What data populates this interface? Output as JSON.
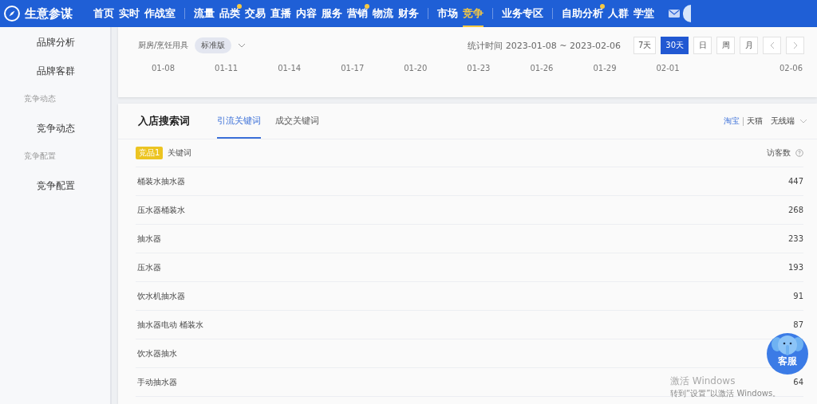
{
  "app": {
    "name": "生意参谋"
  },
  "nav": [
    [
      {
        "label": "首页",
        "selected": false,
        "dot": false
      },
      {
        "label": "实时",
        "selected": false,
        "dot": false
      },
      {
        "label": "作战室",
        "selected": false,
        "dot": false
      }
    ],
    [
      {
        "label": "流量",
        "selected": false,
        "dot": false
      },
      {
        "label": "品类",
        "selected": false,
        "dot": true
      },
      {
        "label": "交易",
        "selected": false,
        "dot": false
      },
      {
        "label": "直播",
        "selected": false,
        "dot": false
      },
      {
        "label": "内容",
        "selected": false,
        "dot": false
      },
      {
        "label": "服务",
        "selected": false,
        "dot": false
      },
      {
        "label": "营销",
        "selected": false,
        "dot": true
      },
      {
        "label": "物流",
        "selected": false,
        "dot": false
      },
      {
        "label": "财务",
        "selected": false,
        "dot": false
      }
    ],
    [
      {
        "label": "市场",
        "selected": false,
        "dot": false
      },
      {
        "label": "竞争",
        "selected": true,
        "dot": false
      }
    ],
    [
      {
        "label": "业务专区",
        "selected": false,
        "dot": false
      }
    ],
    [
      {
        "label": "自助分析",
        "selected": false,
        "dot": true
      },
      {
        "label": "人群",
        "selected": false,
        "dot": false
      },
      {
        "label": "学堂",
        "selected": false,
        "dot": false
      }
    ]
  ],
  "sidebar": [
    {
      "kind": "item",
      "label": "品牌分析"
    },
    {
      "kind": "item",
      "label": "品牌客群"
    },
    {
      "kind": "section",
      "label": "竞争动态"
    },
    {
      "kind": "item",
      "label": "竞争动态"
    },
    {
      "kind": "section",
      "label": "竞争配置"
    },
    {
      "kind": "item",
      "label": "竞争配置"
    }
  ],
  "filter": {
    "category": "厨房/烹饪用具",
    "edition": "标准版",
    "period_label": "统计时间 2023-01-08 ~ 2023-02-06",
    "ranges": [
      {
        "label": "7天",
        "selected": false
      },
      {
        "label": "30天",
        "selected": true
      },
      {
        "label": "日",
        "selected": false
      },
      {
        "label": "周",
        "selected": false
      },
      {
        "label": "月",
        "selected": false
      }
    ]
  },
  "axis_labels": [
    "01-08",
    "01-11",
    "01-14",
    "01-17",
    "01-20",
    "01-23",
    "01-26",
    "01-29",
    "02-01",
    "02-06"
  ],
  "keywords": {
    "title": "入店搜索词",
    "tabs": [
      {
        "label": "引流关键词",
        "selected": true
      },
      {
        "label": "成交关键词",
        "selected": false
      }
    ],
    "platforms": [
      {
        "label": "淘宝",
        "selected": true
      },
      {
        "label": "天猫",
        "selected": false
      }
    ],
    "device": "无线端",
    "badge": "竞品1",
    "columns": [
      "关键词",
      "访客数"
    ],
    "rows": [
      {
        "keyword": "桶装水抽水器",
        "visitors": "447"
      },
      {
        "keyword": "压水器桶装水",
        "visitors": "268"
      },
      {
        "keyword": "抽水器",
        "visitors": "233"
      },
      {
        "keyword": "压水器",
        "visitors": "193"
      },
      {
        "keyword": "饮水机抽水器",
        "visitors": "91"
      },
      {
        "keyword": "抽水器电动 桶装水",
        "visitors": "87"
      },
      {
        "keyword": "饮水器抽水"
      },
      {
        "keyword": "手动抽水器",
        "visitors": "64"
      }
    ]
  },
  "service_button": "客服",
  "activation": {
    "title": "激活 Windows",
    "hint": "转到“设置”以激活 Windows。"
  }
}
